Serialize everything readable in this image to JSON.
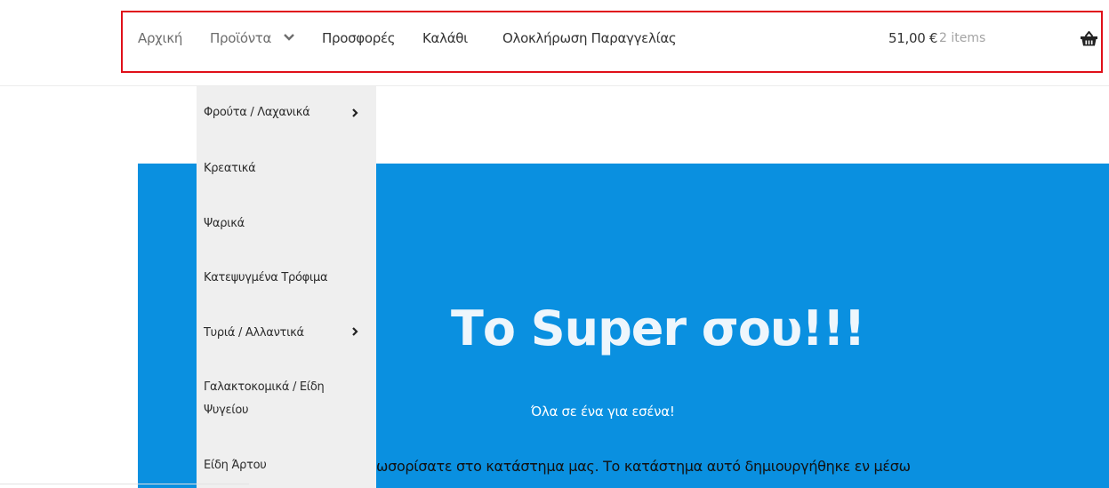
{
  "nav": {
    "items": [
      {
        "label": "Αρχική"
      },
      {
        "label": "Προϊόντα"
      },
      {
        "label": "Προσφορές"
      },
      {
        "label": "Καλάθι"
      },
      {
        "label": "Ολοκλήρωση Παραγγελίας"
      }
    ],
    "cart_total": "51,00 €",
    "cart_count": "2 items",
    "icons": {
      "products_chevron": "chevron-down-icon",
      "cart": "basket-icon"
    },
    "highlight_color": "#e0101a"
  },
  "dropdown": {
    "items": [
      {
        "label": "Φρούτα / Λαχανικά",
        "submenu": true
      },
      {
        "label": "Κρεατικά",
        "submenu": false
      },
      {
        "label": "Ψαρικά",
        "submenu": false
      },
      {
        "label": "Κατεψυγμένα Τρόφιμα",
        "submenu": false
      },
      {
        "label": "Τυριά / Αλλαντικά",
        "submenu": true
      },
      {
        "label": "Γαλακτοκομικά / Είδη Ψυγείου",
        "submenu": false
      },
      {
        "label": "Είδη Άρτου",
        "submenu": false
      }
    ]
  },
  "hero": {
    "title": "Το Super σου!!!",
    "subtitle": "Όλα σε ένα για εσένα!",
    "body": "ωσορίσατε στο κατάστημα μας. Το κατάστημα αυτό δημιουργήθηκε εν μέσω",
    "background_color": "#0a90e0"
  }
}
